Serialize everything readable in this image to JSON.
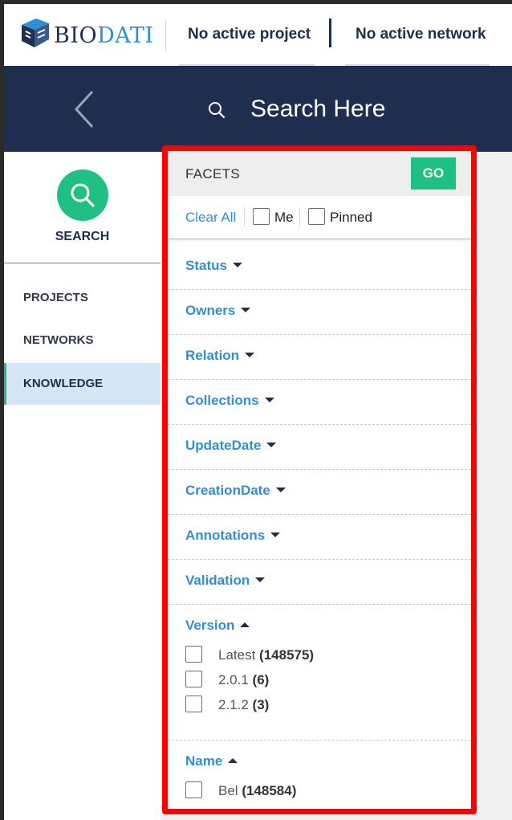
{
  "header": {
    "logo_text_dark": "BIO",
    "logo_text_accent": "DATI",
    "project": "No active project",
    "network": "No active network"
  },
  "searchbar": {
    "label": "Search Here"
  },
  "sidebar": {
    "search_caption": "SEARCH",
    "items": [
      {
        "label": "PROJECTS",
        "active": false
      },
      {
        "label": "NETWORKS",
        "active": false
      },
      {
        "label": "KNOWLEDGE",
        "active": true
      }
    ]
  },
  "facets": {
    "title": "FACETS",
    "go_label": "GO",
    "clear_all": "Clear All",
    "me_label": "Me",
    "pinned_label": "Pinned",
    "collapsed": [
      {
        "label": "Status"
      },
      {
        "label": "Owners"
      },
      {
        "label": "Relation"
      },
      {
        "label": "Collections"
      },
      {
        "label": "UpdateDate"
      },
      {
        "label": "CreationDate"
      },
      {
        "label": "Annotations"
      },
      {
        "label": "Validation"
      }
    ],
    "version": {
      "label": "Version",
      "options": [
        {
          "label": "Latest",
          "count": "(148575)"
        },
        {
          "label": "2.0.1",
          "count": "(6)"
        },
        {
          "label": "2.1.2",
          "count": "(3)"
        }
      ]
    },
    "name": {
      "label": "Name",
      "options": [
        {
          "label": "Bel",
          "count": "(148584)"
        }
      ]
    }
  },
  "colors": {
    "navy": "#1f2d4f",
    "green": "#1fc084",
    "link_blue": "#2f8fd6",
    "highlight_red": "#ff0000",
    "active_nav_bg": "#d4e6f8"
  }
}
